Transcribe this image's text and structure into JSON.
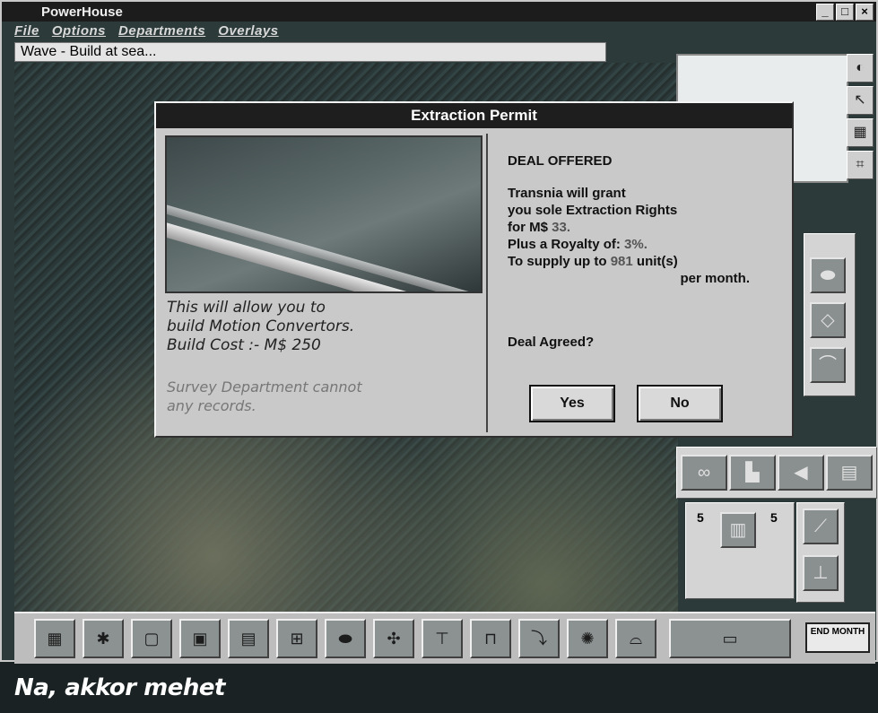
{
  "window": {
    "title": "PowerHouse"
  },
  "menu": [
    "File",
    "Options",
    "Departments",
    "Overlays"
  ],
  "status_line": "Wave - Build at sea...",
  "dialog": {
    "title": "Extraction Permit",
    "info_line1": "This will allow you to",
    "info_line2": "build Motion Convertors.",
    "info_line3": "Build Cost :- M$ 250",
    "survey_line1": "Survey Department cannot",
    "survey_line2": "any records.",
    "deal_heading": "DEAL OFFERED",
    "deal_line1": "Transnia will grant",
    "deal_line2": "you sole Extraction Rights",
    "deal_line3_prefix": "for M$",
    "deal_cost": "33.",
    "deal_line4_prefix": "Plus a Royalty of:",
    "royalty": "3%.",
    "deal_line5_prefix": "To supply up to",
    "supply": "981",
    "deal_line5_suffix": "unit(s)",
    "deal_line6": "per month.",
    "agreed_label": "Deal Agreed?",
    "yes_label": "Yes",
    "no_label": "No"
  },
  "side_counters": {
    "left": "5",
    "right": "5"
  },
  "end_button_label": "END MONTH",
  "caption": "Na, akkor mehet"
}
